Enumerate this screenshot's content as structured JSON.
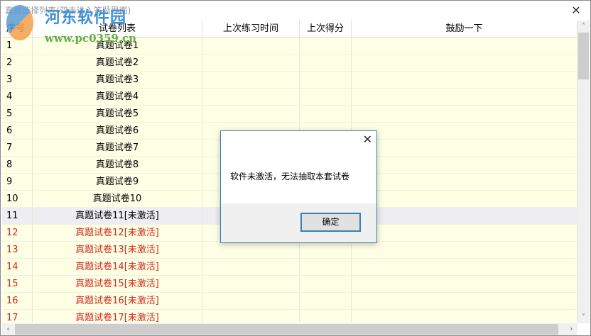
{
  "window": {
    "title": "真题选择列表(双击进入答题界面)",
    "close_icon": "close-icon"
  },
  "watermark": {
    "name": "河东软件园",
    "url": "www.pc0359.cn"
  },
  "table": {
    "headers": [
      "序号",
      "试卷列表",
      "上次练习时间",
      "上次得分",
      "鼓励一下"
    ],
    "rows": [
      {
        "no": "1",
        "name": "真题试卷1",
        "state": "normal"
      },
      {
        "no": "2",
        "name": "真题试卷2",
        "state": "normal"
      },
      {
        "no": "3",
        "name": "真题试卷3",
        "state": "normal"
      },
      {
        "no": "4",
        "name": "真题试卷4",
        "state": "normal"
      },
      {
        "no": "5",
        "name": "真题试卷5",
        "state": "normal"
      },
      {
        "no": "6",
        "name": "真题试卷6",
        "state": "normal"
      },
      {
        "no": "7",
        "name": "真题试卷7",
        "state": "normal"
      },
      {
        "no": "8",
        "name": "真题试卷8",
        "state": "normal"
      },
      {
        "no": "9",
        "name": "真题试卷9",
        "state": "normal"
      },
      {
        "no": "10",
        "name": "真题试卷10",
        "state": "normal"
      },
      {
        "no": "11",
        "name": "真题试卷11[未激活]",
        "state": "selected"
      },
      {
        "no": "12",
        "name": "真题试卷12[未激活]",
        "state": "inactive"
      },
      {
        "no": "13",
        "name": "真题试卷13[未激活]",
        "state": "inactive"
      },
      {
        "no": "14",
        "name": "真题试卷14[未激活]",
        "state": "inactive"
      },
      {
        "no": "15",
        "name": "真题试卷15[未激活]",
        "state": "inactive"
      },
      {
        "no": "16",
        "name": "真题试卷16[未激活]",
        "state": "inactive"
      },
      {
        "no": "17",
        "name": "真题试卷17[未激活]",
        "state": "inactive"
      }
    ]
  },
  "dialog": {
    "message": "软件未激活，无法抽取本套试卷",
    "ok_label": "确定"
  },
  "colors": {
    "row_bg": "#ffffe6",
    "selected_bg": "#eeeef2",
    "inactive_text": "#d02a1e",
    "accent": "#3c7fb1"
  }
}
